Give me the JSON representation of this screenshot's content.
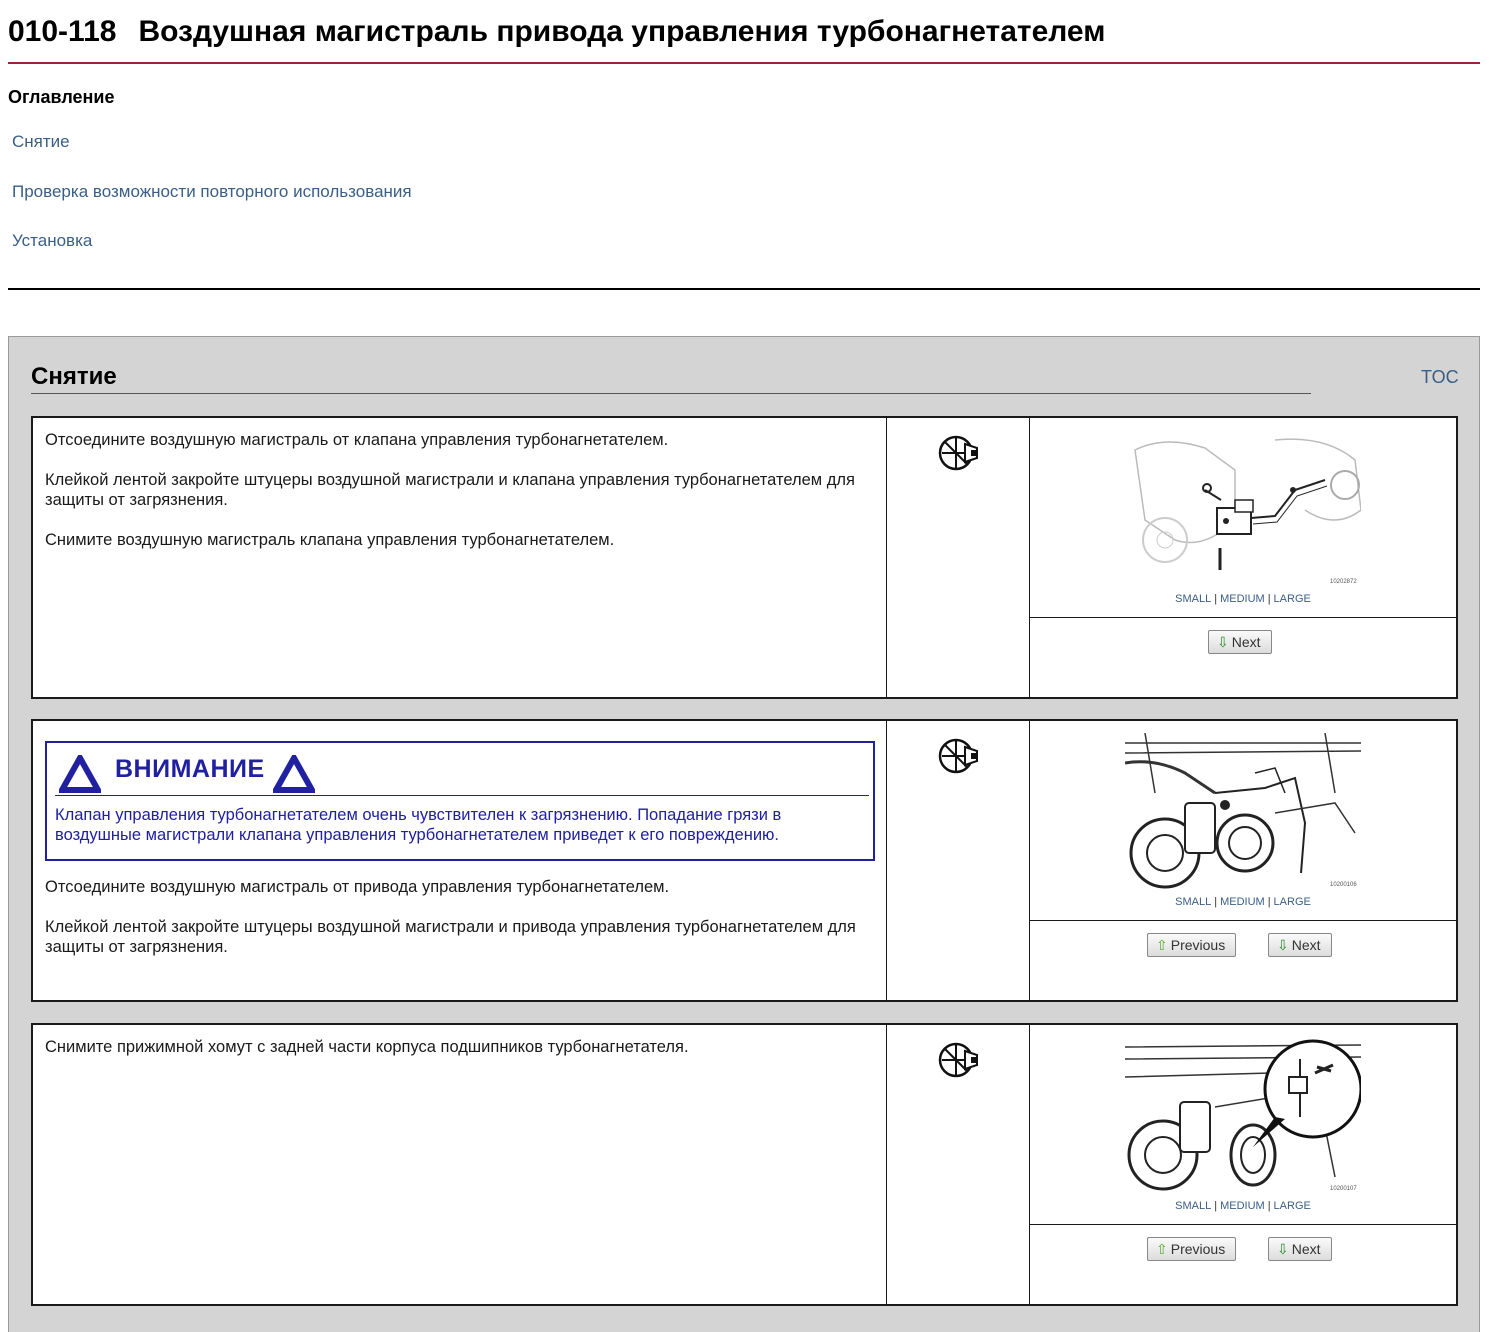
{
  "header": {
    "doc_number": "010-118",
    "title": "Воздушная магистраль привода управления турбонагнетателем"
  },
  "toc": {
    "title": "Оглавление",
    "links": [
      "Снятие",
      "Проверка возможности повторного использования",
      "Установка"
    ]
  },
  "section": {
    "title": "Снятие",
    "toc_link": "TOC",
    "size_links": {
      "small": "SMALL",
      "medium": "MEDIUM",
      "large": "LARGE"
    },
    "buttons": {
      "previous": "Previous",
      "next": "Next"
    },
    "steps": [
      {
        "paragraphs": [
          "Отсоедините воздушную магистраль от клапана управления турбонагнетателем.",
          "Клейкой лентой закройте штуцеры воздушной магистрали и клапана управления турбонагнетателем для защиты от загрязнения.",
          "Снимите воздушную магистраль клапана управления турбонагнетателем."
        ],
        "image_id": "10202872"
      },
      {
        "warning": {
          "title": "ВНИМАНИЕ",
          "text": "Клапан управления турбонагнетателем очень чувствителен к загрязнению. Попадание грязи в воздушные магистрали клапана управления турбонагнетателем приведет к его повреждению."
        },
        "paragraphs": [
          "Отсоедините воздушную магистраль от привода управления турбонагнетателем.",
          "Клейкой лентой закройте штуцеры воздушной магистрали и привода управления турбонагнетателем для защиты от загрязнения."
        ],
        "image_id": "10200106"
      },
      {
        "paragraphs": [
          "Снимите прижимной хомут с задней части корпуса подшипников турбонагнетателя."
        ],
        "image_id": "10200107"
      }
    ]
  }
}
